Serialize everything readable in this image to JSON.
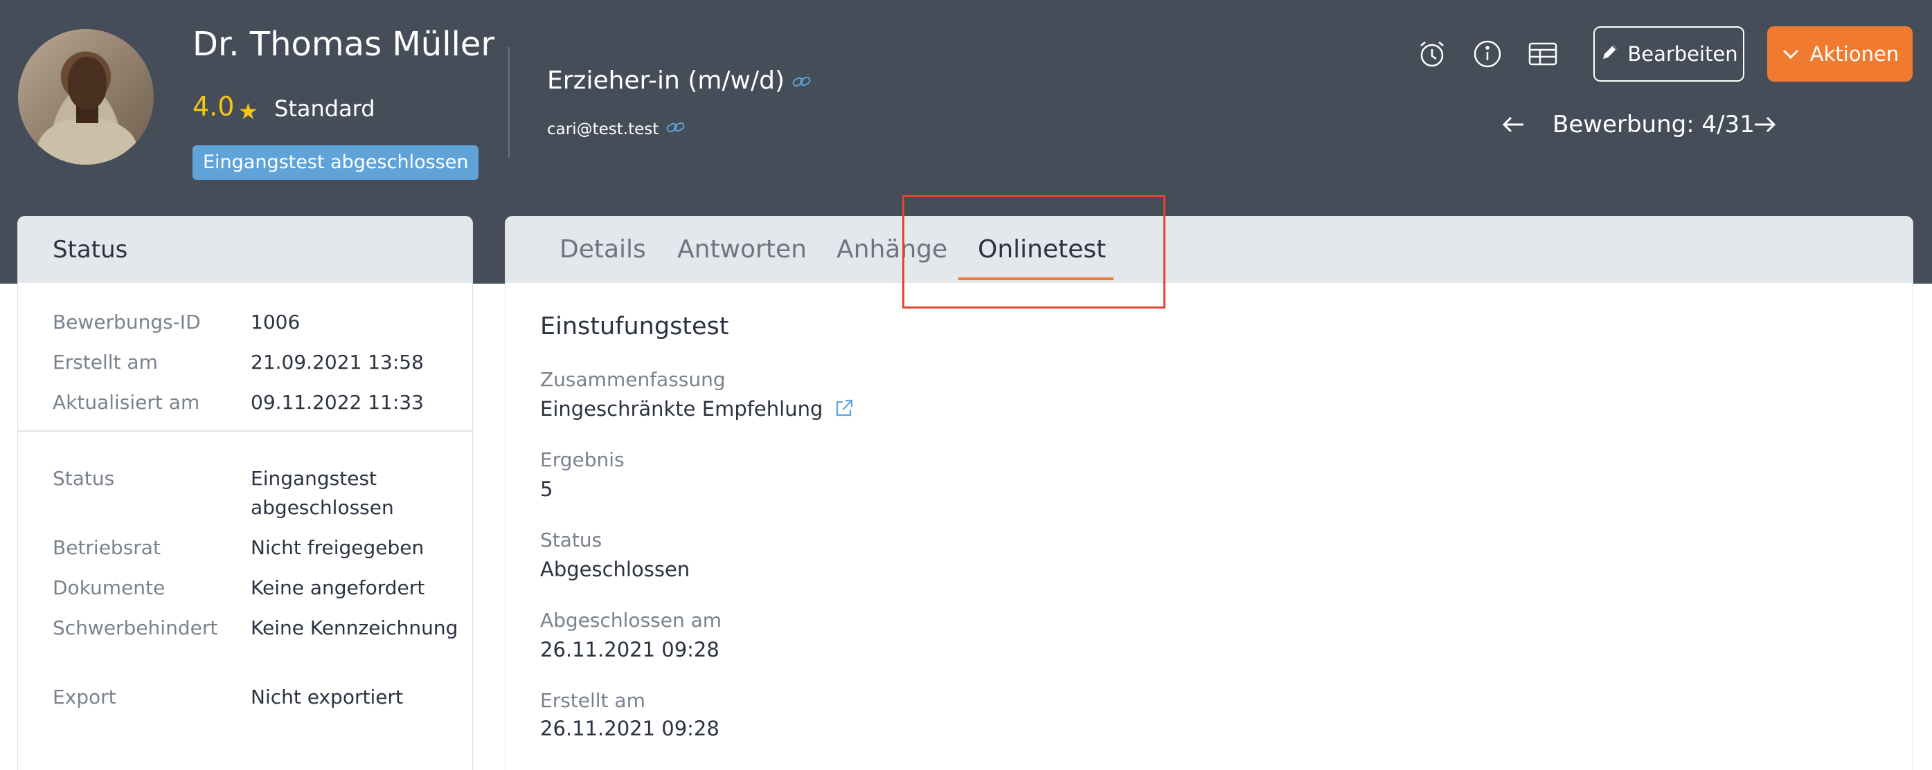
{
  "header": {
    "name": "Dr. Thomas Müller",
    "rating": "4.0",
    "tier": "Standard",
    "badge": "Eingangstest abgeschlossen",
    "job_title": "Erzieher-in (m/w/d)",
    "email": "cari@test.test",
    "edit_label": "Bearbeiten",
    "actions_label": "Aktionen",
    "pager_label": "Bewerbung: 4/31",
    "icons": [
      "alarm-clock-icon",
      "info-icon",
      "table-icon"
    ]
  },
  "status_card": {
    "title": "Status",
    "meta": [
      {
        "label": "Bewerbungs-ID",
        "value": "1006"
      },
      {
        "label": "Erstellt am",
        "value": "21.09.2021 13:58"
      },
      {
        "label": "Aktualisiert am",
        "value": "09.11.2022 11:33"
      }
    ],
    "details": [
      {
        "label": "Status",
        "value": "Eingangstest abgeschlossen"
      },
      {
        "label": "Betriebsrat",
        "value": "Nicht freigegeben"
      },
      {
        "label": "Dokumente",
        "value": "Keine angefordert"
      },
      {
        "label": "Schwerbehindert",
        "value": "Keine Kennzeichnung"
      },
      {
        "label": "Export",
        "value": "Nicht exportiert"
      }
    ]
  },
  "tabs": [
    "Details",
    "Antworten",
    "Anhänge",
    "Onlinetest"
  ],
  "active_tab": "Onlinetest",
  "onlinetest": {
    "title": "Einstufungstest",
    "fields": [
      {
        "label": "Zusammenfassung",
        "value": "Eingeschränkte Empfehlung"
      },
      {
        "label": "Ergebnis",
        "value": "5"
      },
      {
        "label": "Status",
        "value": "Abgeschlossen"
      },
      {
        "label": "Abgeschlossen am",
        "value": "26.11.2021 09:28"
      },
      {
        "label": "Erstellt am",
        "value": "26.11.2021 09:28"
      }
    ]
  },
  "colors": {
    "header_bg": "#454d59",
    "accent": "#f07a30",
    "badge": "#5fa3d9",
    "star": "#f5c518",
    "highlight_box": "#e34531"
  }
}
